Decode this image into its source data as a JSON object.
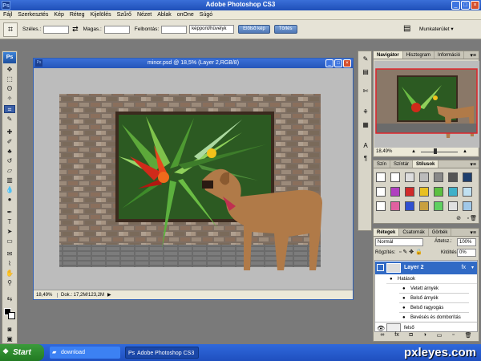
{
  "app": {
    "title": "Adobe Photoshop CS3",
    "icon": "Ps"
  },
  "menu": [
    "Fájl",
    "Szerkesztés",
    "Kép",
    "Réteg",
    "Kijelölés",
    "Szűrő",
    "Nézet",
    "Ablak",
    "onOne",
    "Súgó"
  ],
  "options": {
    "width_label": "Széles.:",
    "height_label": "Magas.:",
    "resolution_label": "Felbontás:",
    "unit_select": "képpont/hüvelyk",
    "front_image_button": "Előlső kép",
    "clear_button": "Törlés",
    "workspace_label": "Munkaterület ▾"
  },
  "document": {
    "title": "minor.psd @ 18,5% (Layer 2,RGB/8)",
    "zoom": "18,49%",
    "doc_info": "Dok.: 17,2M/123,2M"
  },
  "navigator": {
    "tabs": [
      "Navigátor",
      "Hisztogram",
      "Információ"
    ],
    "zoom": "18,49%"
  },
  "styles_panel": {
    "tabs": [
      "Szín",
      "Színtár",
      "Stílusok"
    ]
  },
  "layers_panel": {
    "tabs": [
      "Rétegek",
      "Csatornák",
      "Görbék"
    ],
    "blend_mode": "Normál",
    "opacity_label": "Áttetsz.:",
    "opacity_value": "100%",
    "lock_label": "Rögzítés:",
    "fill_label": "Kitöltés:",
    "fill_value": "0%",
    "layer2_name": "Layer 2",
    "effects_label": "Hatások",
    "effects": [
      "Vetett árnyék",
      "Belső árnyék",
      "Belső ragyogás",
      "Bevésés és domborítás"
    ],
    "bottom_layer_name": "felső"
  },
  "taskbar": {
    "start": "Start",
    "items": [
      "download",
      "Adobe Photoshop CS3"
    ]
  },
  "watermark": "pxleyes.com",
  "colors": {
    "accent": "#316ac5",
    "selected_layer": "#316ac5",
    "taskbar": "#245edb"
  }
}
